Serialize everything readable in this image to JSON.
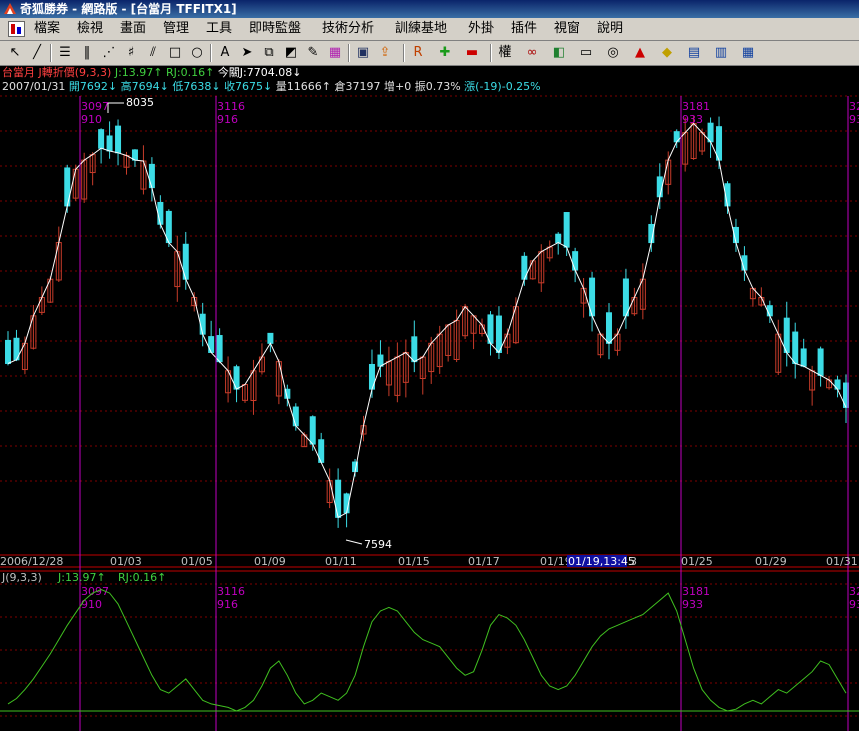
{
  "window": {
    "title": "奇狐勝券 - 網路版 - [台當月 TFFITX1]"
  },
  "menu": [
    "檔案",
    "檢視",
    "畫面",
    "管理",
    "工具",
    "即時監盤",
    "技術分析",
    "訓練基地",
    "外掛",
    "插件",
    "視窗",
    "說明"
  ],
  "toolbar": {
    "icons": [
      "cursor-icon",
      "line-icon",
      "text-line-icon",
      "vertical-lines-icon",
      "fan-icon",
      "gann-icon",
      "parallel-icon",
      "rectangle-icon",
      "ellipse-icon",
      "text-icon",
      "arrow-icon",
      "copy-icon",
      "eraser-icon",
      "pencil-icon",
      "palette-icon",
      "save-icon",
      "export-icon",
      "rsi-icon",
      "crosshair-icon",
      "minus-icon",
      "rights-icon",
      "glasses-icon",
      "stock-icon",
      "book-icon",
      "filter-icon",
      "alarm-icon",
      "tag-icon",
      "layout-1-icon",
      "layout-2-icon",
      "layout-3-icon"
    ],
    "rights_label": "權",
    "rsi_label": "RSI"
  },
  "header": {
    "line1": {
      "name": "台當月",
      "indicator": "J轉折價(9,3,3)",
      "j": "J:13.97↑",
      "rj": "RJ:0.16↑",
      "today": "今關J:7704.08↓"
    },
    "line2": {
      "date": "2007/01/31",
      "open": "開7692↓",
      "high": "高7694↓",
      "low": "低7638↓",
      "close": "收7675↓",
      "vol": "量11666↑",
      "oi": "倉37197",
      "inc": "增+0",
      "amp": "振0.73%",
      "chg": "漲(-19)-0.25%"
    }
  },
  "colors": {
    "up": "#c83c2a",
    "down": "#3cdce6",
    "line": "#ffffff",
    "marker": "#c000c0",
    "osc": "#40c020",
    "grid": "#800000",
    "axis": "#c0c0c0"
  },
  "price_annotations": {
    "high": "8035",
    "low": "7594"
  },
  "markers": [
    {
      "code": "3097",
      "sub": "910"
    },
    {
      "code": "3116",
      "sub": "916"
    },
    {
      "code": "3181",
      "sub": "933"
    },
    {
      "code": "32",
      "sub": "93"
    }
  ],
  "xaxis": {
    "labels": [
      "2006/12/28",
      "01/03",
      "01/05",
      "01/09",
      "01/11",
      "01/15",
      "01/17",
      "01/19",
      "01/25",
      "01/29",
      "01/31"
    ],
    "cursor": "01/19,13:45",
    "cursor_tail": "3"
  },
  "osc_header": {
    "label": "J(9,3,3)",
    "j": "J:13.97↑",
    "rj": "RJ:0.16↑"
  },
  "chart_data": {
    "type": "candlestick",
    "high_label": 8035,
    "low_label": 7594,
    "close_path": [
      7768,
      7772,
      7790,
      7820,
      7840,
      7860,
      7900,
      7940,
      7980,
      7990,
      7996,
      8003,
      8000,
      7998,
      7995,
      7990,
      7989,
      7960,
      7920,
      7900,
      7890,
      7860,
      7840,
      7800,
      7780,
      7770,
      7760,
      7740,
      7745,
      7760,
      7775,
      7790,
      7770,
      7730,
      7700,
      7690,
      7680,
      7660,
      7640,
      7600,
      7605,
      7650,
      7700,
      7740,
      7765,
      7770,
      7775,
      7780,
      7770,
      7775,
      7790,
      7800,
      7810,
      7815,
      7830,
      7820,
      7810,
      7790,
      7780,
      7800,
      7830,
      7860,
      7880,
      7890,
      7895,
      7900,
      7895,
      7870,
      7850,
      7820,
      7800,
      7790,
      7800,
      7820,
      7840,
      7860,
      7900,
      7950,
      7990,
      8010,
      8020,
      8030,
      8020,
      8010,
      7990,
      7940,
      7900,
      7870,
      7850,
      7840,
      7820,
      7800,
      7780,
      7768,
      7765,
      7760,
      7755,
      7750,
      7740,
      7720
    ]
  },
  "osc_data": {
    "type": "line",
    "values": [
      4,
      7,
      12,
      18,
      25,
      32,
      40,
      48,
      55,
      62,
      66,
      68,
      66,
      60,
      50,
      40,
      30,
      20,
      12,
      10,
      14,
      18,
      12,
      6,
      4,
      3,
      2,
      0,
      2,
      6,
      14,
      24,
      28,
      20,
      10,
      4,
      6,
      10,
      8,
      6,
      10,
      20,
      36,
      50,
      56,
      58,
      56,
      50,
      44,
      40,
      38,
      36,
      30,
      24,
      20,
      22,
      34,
      48,
      54,
      52,
      48,
      40,
      30,
      20,
      14,
      12,
      14,
      20,
      28,
      36,
      42,
      46,
      48,
      50,
      52,
      54,
      58,
      62,
      66,
      56,
      40,
      24,
      12,
      6,
      2,
      0,
      1,
      4,
      6,
      4,
      8,
      12,
      10,
      14,
      18,
      22,
      28,
      26,
      18,
      10
    ]
  }
}
